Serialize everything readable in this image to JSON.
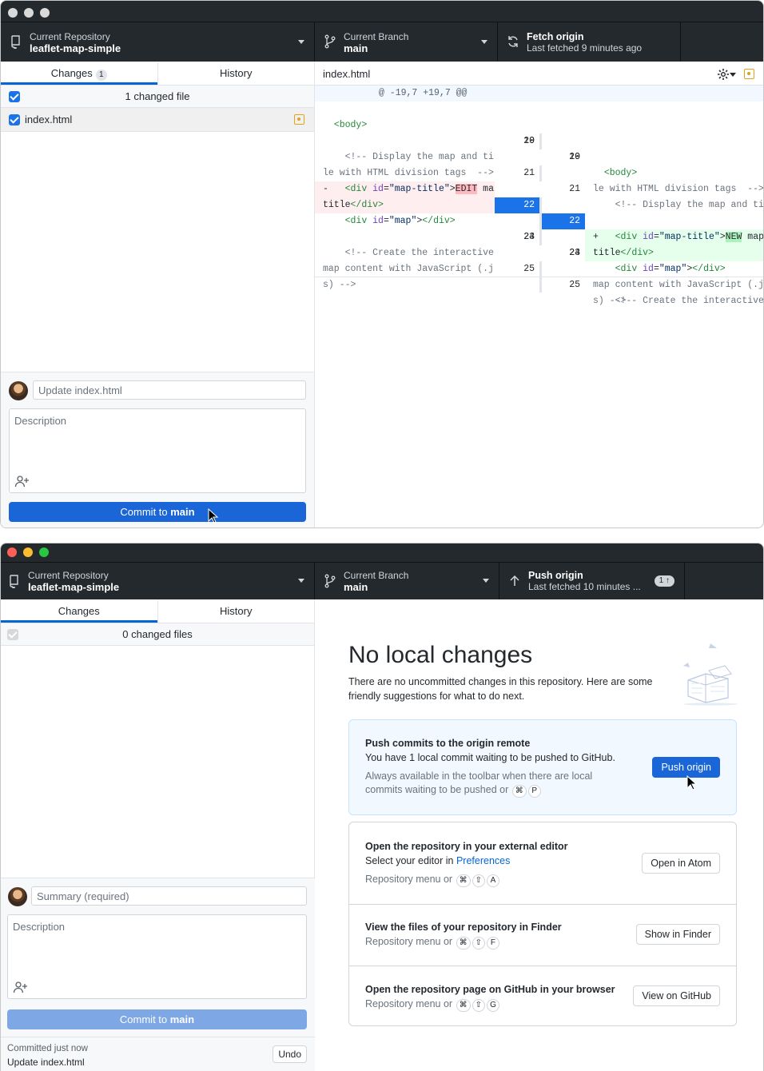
{
  "colors": {
    "accent": "#1a66d9",
    "toolbar": "#24292e",
    "modified": "#e3a21a"
  },
  "w1": {
    "toolbar": {
      "repo_label": "Current Repository",
      "repo_value": "leaflet-map-simple",
      "branch_label": "Current Branch",
      "branch_value": "main",
      "fetch_label": "Fetch origin",
      "fetch_sub": "Last fetched 9 minutes ago"
    },
    "tabs": {
      "changes": "Changes",
      "changes_count": "1",
      "history": "History"
    },
    "changed_files": "1 changed file",
    "file": "index.html",
    "diff_file": "index.html",
    "hunk": "@ -19,7 +19,7 @@",
    "summary_placeholder": "Update index.html",
    "description_placeholder": "Description",
    "commit_prefix": "Commit to ",
    "commit_branch": "main"
  },
  "w2": {
    "toolbar": {
      "repo_label": "Current Repository",
      "repo_value": "leaflet-map-simple",
      "branch_label": "Current Branch",
      "branch_value": "main",
      "push_label": "Push origin",
      "push_sub": "Last fetched 10 minutes ...",
      "push_count": "1 ↑"
    },
    "tabs": {
      "changes": "Changes",
      "history": "History"
    },
    "changed_files": "0 changed files",
    "summary_placeholder": "Summary (required)",
    "description_placeholder": "Description",
    "commit_prefix": "Commit to ",
    "commit_branch": "main",
    "last_commit_label": "Committed just now",
    "last_commit_msg": "Update index.html",
    "undo": "Undo",
    "title": "No local changes",
    "intro": "There are no uncommitted changes in this repository. Here are some friendly suggestions for what to do next.",
    "push_card": {
      "title": "Push commits to the origin remote",
      "sub": "You have 1 local commit waiting to be pushed to GitHub.",
      "meta1": "Always available in the toolbar when there are local",
      "meta2": "commits waiting to be pushed or",
      "button": "Push origin"
    },
    "editor_card": {
      "title": "Open the repository in your external editor",
      "sub_prefix": "Select your editor in ",
      "sub_link": "Preferences",
      "meta": "Repository menu or",
      "button": "Open in Atom"
    },
    "finder_card": {
      "title": "View the files of your repository in Finder",
      "meta": "Repository menu or",
      "button": "Show in Finder"
    },
    "github_card": {
      "title": "Open the repository page on GitHub in your browser",
      "meta": "Repository menu or",
      "button": "View on GitHub"
    },
    "keys": {
      "cmd": "⌘",
      "shift": "⇧",
      "p": "P",
      "a": "A",
      "f": "F",
      "g": "G"
    }
  }
}
